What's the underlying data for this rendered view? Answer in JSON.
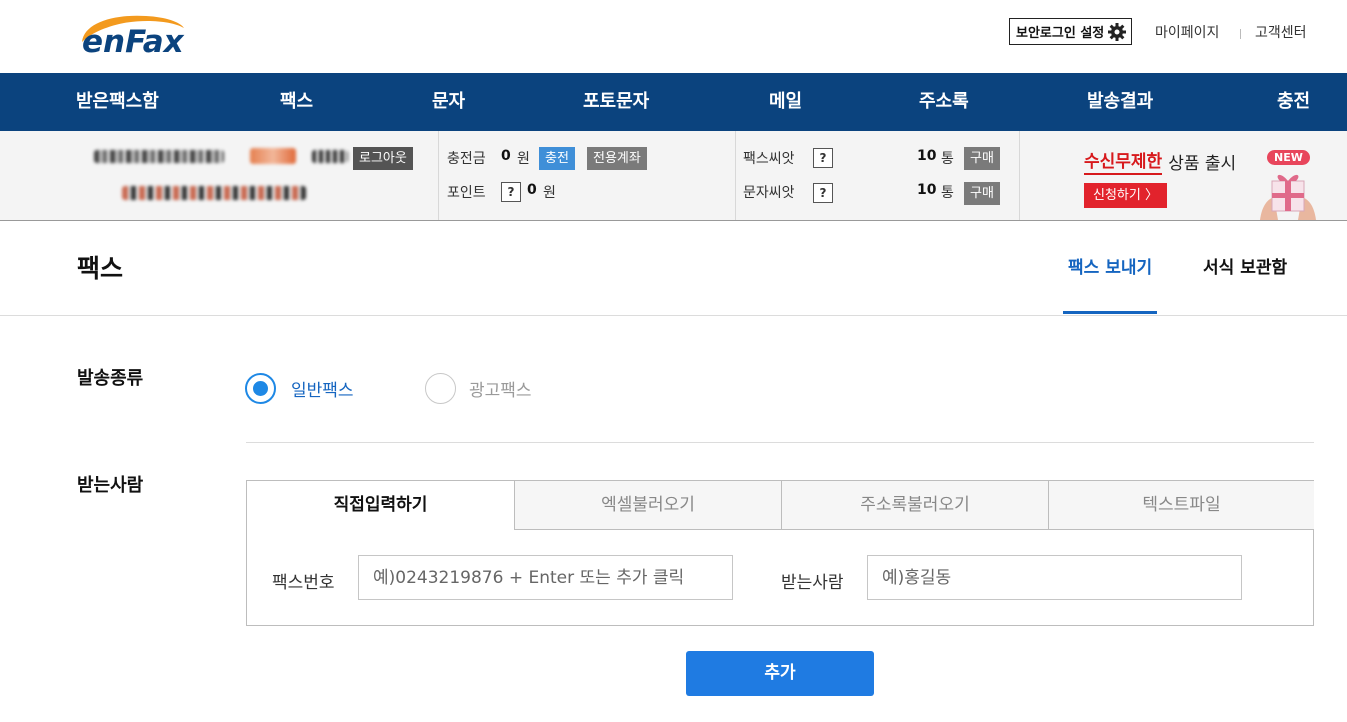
{
  "header": {
    "logo_text": "enFax",
    "secure_login_label": "보안로그인 설정",
    "links": [
      "마이페이지",
      "고객센터"
    ]
  },
  "nav": {
    "items": [
      "받은팩스함",
      "팩스",
      "문자",
      "포토문자",
      "메일",
      "주소록",
      "발송결과",
      "충전"
    ]
  },
  "account": {
    "logout_label": "로그아웃",
    "balance_label": "충전금",
    "balance_value": "0",
    "balance_unit": "원",
    "charge_button": "충전",
    "dedicated_account_button": "전용계좌",
    "point_label": "포인트",
    "point_help": "?",
    "point_value": "0",
    "point_unit": "원"
  },
  "seeds": {
    "fax_label": "팩스씨앗",
    "fax_help": "?",
    "fax_count": "10",
    "fax_unit": "통",
    "fax_buy": "구매",
    "sms_label": "문자씨앗",
    "sms_help": "?",
    "sms_count": "10",
    "sms_unit": "통",
    "sms_buy": "구매"
  },
  "promo": {
    "highlight": "수신무제한",
    "rest": "상품 출시",
    "badge": "NEW",
    "apply_label": "신청하기 〉"
  },
  "page": {
    "title": "팩스",
    "tabs": [
      "팩스 보내기",
      "서식 보관함"
    ],
    "active_tab": "팩스 보내기"
  },
  "form": {
    "send_type_label": "발송종류",
    "send_types": [
      "일반팩스",
      "광고팩스"
    ],
    "selected_send_type": "일반팩스",
    "recipient_label": "받는사람",
    "recipient_tabs": [
      "직접입력하기",
      "엑셀불러오기",
      "주소록불러오기",
      "텍스트파일"
    ],
    "active_recipient_tab": "직접입력하기",
    "fax_number_label": "팩스번호",
    "fax_number_placeholder": "예)0243219876 + Enter 또는 추가 클릭",
    "recipient_name_label": "받는사람",
    "recipient_name_placeholder": "예)홍길동",
    "add_button": "추가"
  },
  "colors": {
    "nav_bg": "#0b437e",
    "accent_blue": "#1e88e5",
    "promo_red": "#e2232c"
  }
}
